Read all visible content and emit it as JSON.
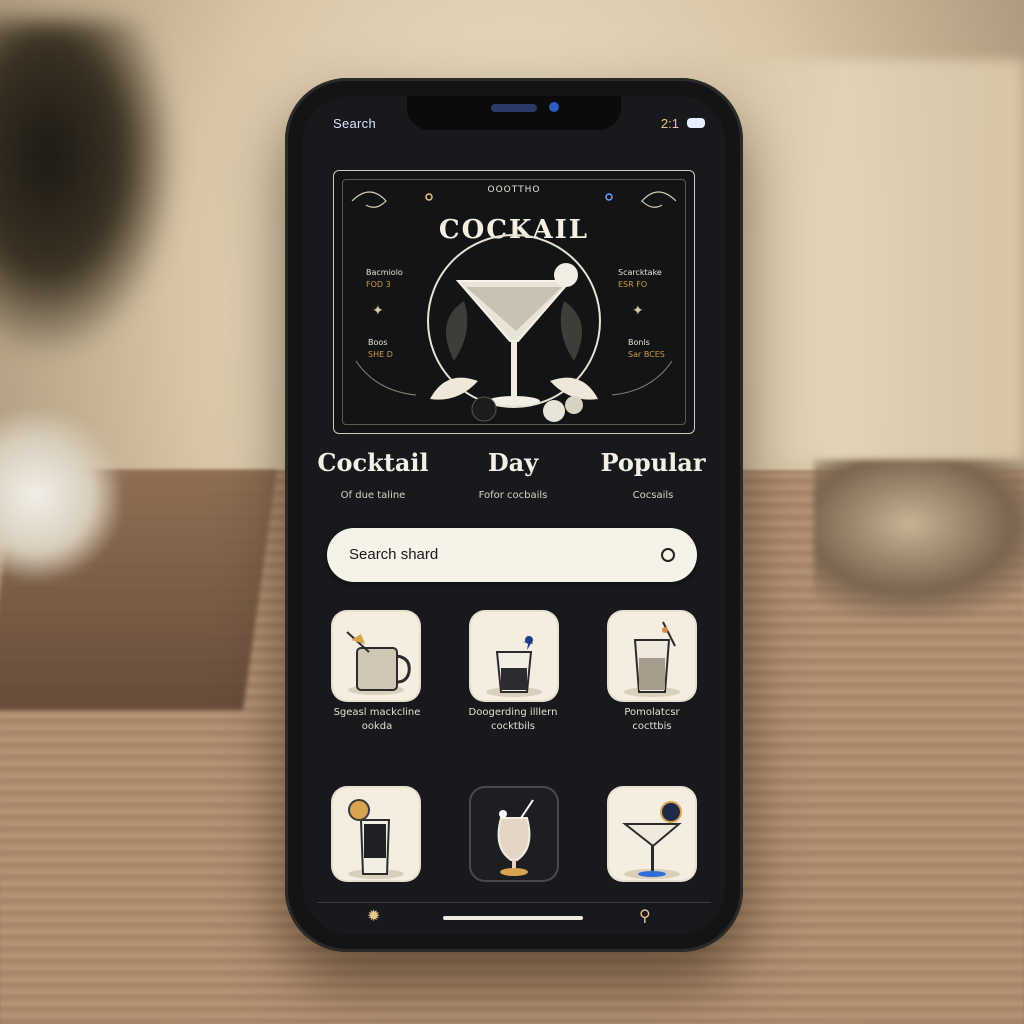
{
  "status_bar": {
    "search_label": "Search",
    "time": "2:1"
  },
  "banner": {
    "top_label": "OOOTTHO",
    "title": "COCKAIL",
    "left_items": [
      {
        "line1": "Bacmiolo",
        "line2": "FOD 3"
      },
      {
        "line1": "Boos",
        "line2": "SHE D"
      }
    ],
    "right_items": [
      {
        "line1": "Scarcktake",
        "line2": "ESR FO"
      },
      {
        "line1": "Bonls",
        "line2": "Sar BCES"
      }
    ]
  },
  "headlines": [
    {
      "title": "Cocktail",
      "subtitle": "Of due taline"
    },
    {
      "title": "Day",
      "subtitle": "Fofor cocbails"
    },
    {
      "title": "Popular",
      "subtitle": "Cocsails"
    }
  ],
  "search": {
    "value": "Search shard"
  },
  "cocktails_row1": [
    {
      "caption_line1": "Sgeasl mackcline",
      "caption_line2": "ookda",
      "icon": "mug-cocktail-icon"
    },
    {
      "caption_line1": "Doogerding illlern",
      "caption_line2": "cocktbils",
      "icon": "shot-glass-flower-icon"
    },
    {
      "caption_line1": "Pomolatcsr",
      "caption_line2": "cocttbis",
      "icon": "highball-glass-icon"
    }
  ],
  "cocktails_row2": [
    {
      "icon": "shot-glass-citrus-icon"
    },
    {
      "icon": "hurricane-glass-icon"
    },
    {
      "icon": "martini-glass-icon"
    }
  ],
  "colors": {
    "accent": "#d19a46",
    "screen": "#17191c",
    "card": "#f4ede0"
  }
}
